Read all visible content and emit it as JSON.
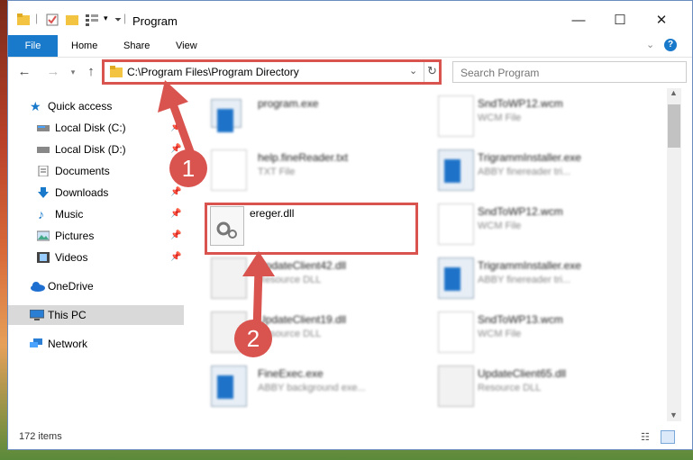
{
  "window": {
    "title": "Program",
    "controls": {
      "minimize": "—",
      "maximize": "☐",
      "close": "✕"
    }
  },
  "ribbon": {
    "tabs": [
      "File",
      "Home",
      "Share",
      "View"
    ]
  },
  "address": {
    "path": "C:\\Program Files\\Program Directory",
    "search_placeholder": "Search Program"
  },
  "navpane": {
    "quick_access": "Quick access",
    "items": [
      {
        "label": "Local Disk (C:)",
        "icon": "drive-icon",
        "pinned": true
      },
      {
        "label": "Local Disk (D:)",
        "icon": "drive-icon",
        "pinned": true
      },
      {
        "label": "Documents",
        "icon": "documents-icon",
        "pinned": true
      },
      {
        "label": "Downloads",
        "icon": "downloads-icon",
        "pinned": true
      },
      {
        "label": "Music",
        "icon": "music-icon",
        "pinned": true
      },
      {
        "label": "Pictures",
        "icon": "pictures-icon",
        "pinned": true
      },
      {
        "label": "Videos",
        "icon": "videos-icon",
        "pinned": true
      }
    ],
    "onedrive": "OneDrive",
    "this_pc": "This PC",
    "network": "Network"
  },
  "files": {
    "left": [
      {
        "name": "program.exe",
        "type": ""
      },
      {
        "name": "help.fineReader.txt",
        "type": "TXT File"
      },
      {
        "name": "ereger.dll",
        "type": ""
      },
      {
        "name": "UpdateClient42.dll",
        "type": "Resource DLL"
      },
      {
        "name": "UpdateClient19.dll",
        "type": "Resource DLL"
      },
      {
        "name": "FineExec.exe",
        "type": "ABBY background exe..."
      }
    ],
    "right": [
      {
        "name": "SndToWP12.wcm",
        "type": "WCM File"
      },
      {
        "name": "TrigrammInstaller.exe",
        "type": "ABBY finereader tri..."
      },
      {
        "name": "SndToWP12.wcm",
        "type": "WCM File"
      },
      {
        "name": "TrigrammInstaller.exe",
        "type": "ABBY finereader tri..."
      },
      {
        "name": "SndToWP13.wcm",
        "type": "WCM File"
      },
      {
        "name": "UpdateClient65.dll",
        "type": "Resource DLL"
      }
    ]
  },
  "status": {
    "count": "172 items"
  },
  "annotations": {
    "step1": "1",
    "step2": "2"
  },
  "colors": {
    "accent": "#1979ca",
    "highlight": "#d9534f"
  }
}
